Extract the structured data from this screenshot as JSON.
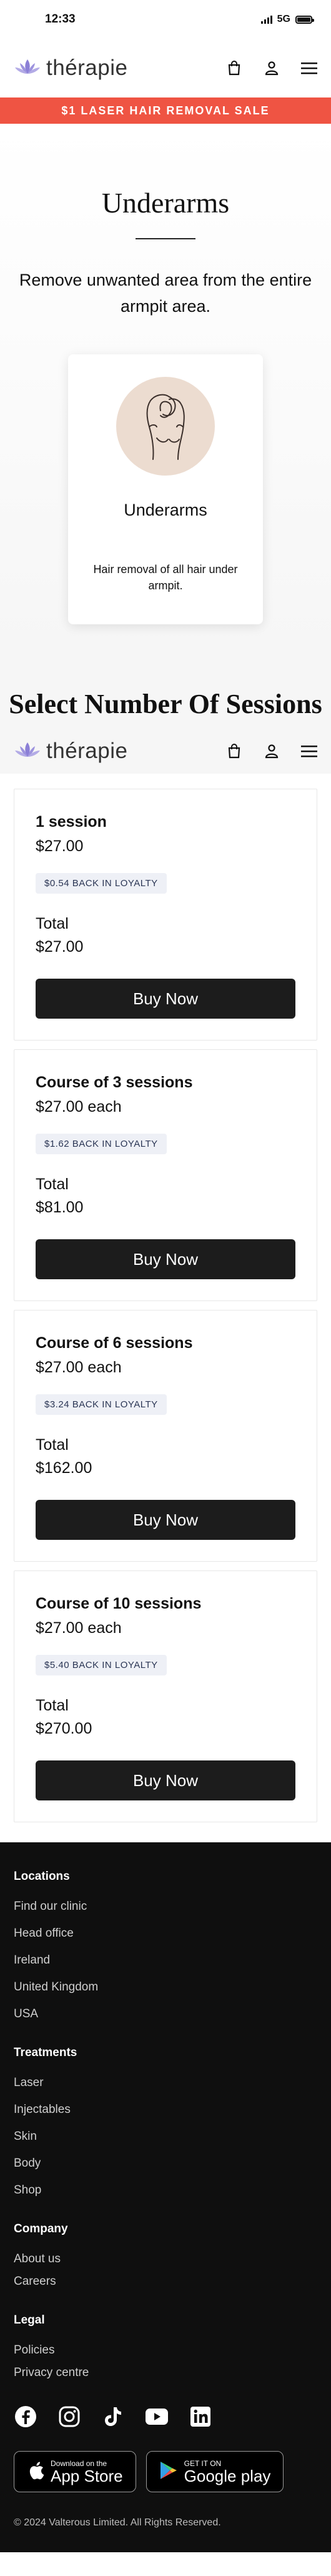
{
  "status_bar": {
    "time": "12:33",
    "network": "5G"
  },
  "header": {
    "logo_text": "thérapie",
    "promo": "$1 LASER HAIR REMOVAL SALE"
  },
  "hero": {
    "title": "Underarms",
    "description": "Remove unwanted area from the entire armpit area."
  },
  "area_card": {
    "name": "Underarms",
    "description": "Hair removal of all hair under armpit."
  },
  "sessions_title": "Select Number Of Sessions",
  "sessions": [
    {
      "name": "1 session",
      "price": "$27.00",
      "loyalty": "$0.54 BACK IN LOYALTY",
      "total_label": "Total",
      "total": "$27.00",
      "button": "Buy Now"
    },
    {
      "name": "Course of 3 sessions",
      "price": "$27.00 each",
      "loyalty": "$1.62 BACK IN LOYALTY",
      "total_label": "Total",
      "total": "$81.00",
      "button": "Buy Now"
    },
    {
      "name": "Course of 6 sessions",
      "price": "$27.00 each",
      "loyalty": "$3.24 BACK IN LOYALTY",
      "total_label": "Total",
      "total": "$162.00",
      "button": "Buy Now"
    },
    {
      "name": "Course of 10 sessions",
      "price": "$27.00 each",
      "loyalty": "$5.40 BACK IN LOYALTY",
      "total_label": "Total",
      "total": "$270.00",
      "button": "Buy Now"
    }
  ],
  "footer": {
    "locations": {
      "heading": "Locations",
      "links": [
        "Find our clinic",
        "Head office",
        "Ireland",
        "United Kingdom",
        "USA"
      ]
    },
    "treatments": {
      "heading": "Treatments",
      "links": [
        "Laser",
        "Injectables",
        "Skin",
        "Body",
        "Shop"
      ]
    },
    "company": {
      "heading": "Company",
      "links": [
        "About us",
        "Careers"
      ]
    },
    "legal": {
      "heading": "Legal",
      "links": [
        "Policies",
        "Privacy centre"
      ]
    },
    "socials": [
      "facebook-icon",
      "instagram-icon",
      "tiktok-icon",
      "youtube-icon",
      "linkedin-icon"
    ],
    "app_store": {
      "small": "Download on the",
      "big": "App Store"
    },
    "google_play": {
      "small": "GET IT ON",
      "big": "Google play"
    },
    "copyright": "© 2024 Valterous Limited. All Rights Reserved."
  },
  "colors": {
    "promo": "#ef5443",
    "logo_accent": "#8b7fd6",
    "button": "#1c1c1c",
    "footer": "#0f0f0f"
  }
}
